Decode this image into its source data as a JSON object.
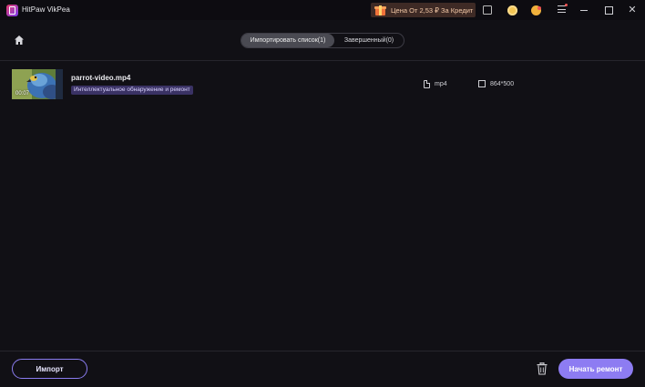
{
  "app": {
    "title": "HitPaw VikPea"
  },
  "promo": {
    "text": "Цена От 2,53 ₽ За Кредит"
  },
  "tabs": [
    {
      "label": "Импортировать список(1)",
      "active": true
    },
    {
      "label": "Завершенный(0)",
      "active": false
    }
  ],
  "file": {
    "name": "parrot-video.mp4",
    "duration": "00:07",
    "model": "Интеллектуальное обнаружение и ремонт",
    "format": "mp4",
    "resolution": "864*500"
  },
  "footer": {
    "import_label": "Импорт",
    "start_label": "Начать ремонт"
  },
  "colors": {
    "background": "#111015",
    "accent": "#8d7cf2",
    "badge_bg": "#3a3264"
  }
}
